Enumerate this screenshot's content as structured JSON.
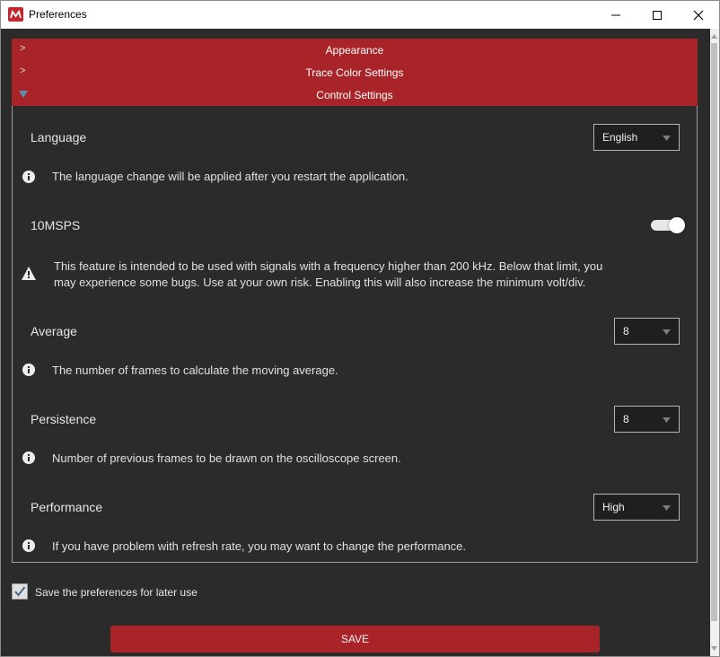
{
  "window": {
    "title": "Preferences",
    "icon": "app-logo-icon",
    "controls": [
      "minimize-icon",
      "maximize-icon",
      "close-icon"
    ]
  },
  "colors": {
    "accent": "#a82428",
    "background": "#2b2b2b",
    "text": "#e6e6e6"
  },
  "accordion": {
    "sections": [
      {
        "label": "Appearance",
        "chevron": ">"
      },
      {
        "label": "Trace Color Settings",
        "chevron": ">"
      },
      {
        "label": "Control Settings",
        "chevron": "v"
      }
    ]
  },
  "settings": {
    "language": {
      "label": "Language",
      "value": "English",
      "note": "The language change will be applied after you restart the application."
    },
    "msps": {
      "label": "10MSPS",
      "enabled": true,
      "warning_line1": "This feature is intended to be used with signals with a frequency higher than 200 kHz. Below that limit, you",
      "warning_line2": "may experience some bugs. Use at your own risk. Enabling this will also increase the minimum volt/div."
    },
    "average": {
      "label": "Average",
      "value": "8",
      "note": "The number of frames to calculate the moving average."
    },
    "persistence": {
      "label": "Persistence",
      "value": "8",
      "note": "Number of previous frames to be drawn on the oscilloscope screen."
    },
    "performance": {
      "label": "Performance",
      "value": "High",
      "note": "If you have problem with refresh rate, you may want to change the performance."
    }
  },
  "save_preferences": {
    "label": "Save the preferences for later use",
    "checked": true
  },
  "save_button": {
    "label": "SAVE"
  }
}
